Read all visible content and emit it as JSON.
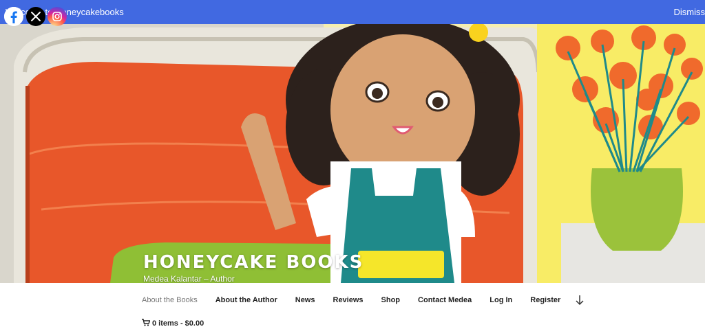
{
  "notice": {
    "text": "Welcome to Honeycakebooks",
    "dismiss": "Dismiss"
  },
  "social": [
    {
      "icon": "facebook-icon",
      "glyph": "f"
    },
    {
      "icon": "x-icon",
      "glyph": "X"
    },
    {
      "icon": "instagram-icon",
      "glyph": ""
    }
  ],
  "site": {
    "title": "HONEYCAKE BOOKS",
    "description": "Medea Kalantar – Author"
  },
  "menu": [
    {
      "label": "About the Books",
      "current": true
    },
    {
      "label": "About the Author"
    },
    {
      "label": "News"
    },
    {
      "label": "Reviews"
    },
    {
      "label": "Shop"
    },
    {
      "label": "Contact Medea"
    },
    {
      "label": "Log In"
    },
    {
      "label": "Register"
    }
  ],
  "cart": {
    "label": "0 items - $0.00",
    "icon": "cart-icon"
  },
  "colors": {
    "notice_bg": "#4169e1",
    "sofa": "#e8572a",
    "dress": "#1f8a8a",
    "flowers": "#f06a2c",
    "vase": "#9bc23b"
  }
}
